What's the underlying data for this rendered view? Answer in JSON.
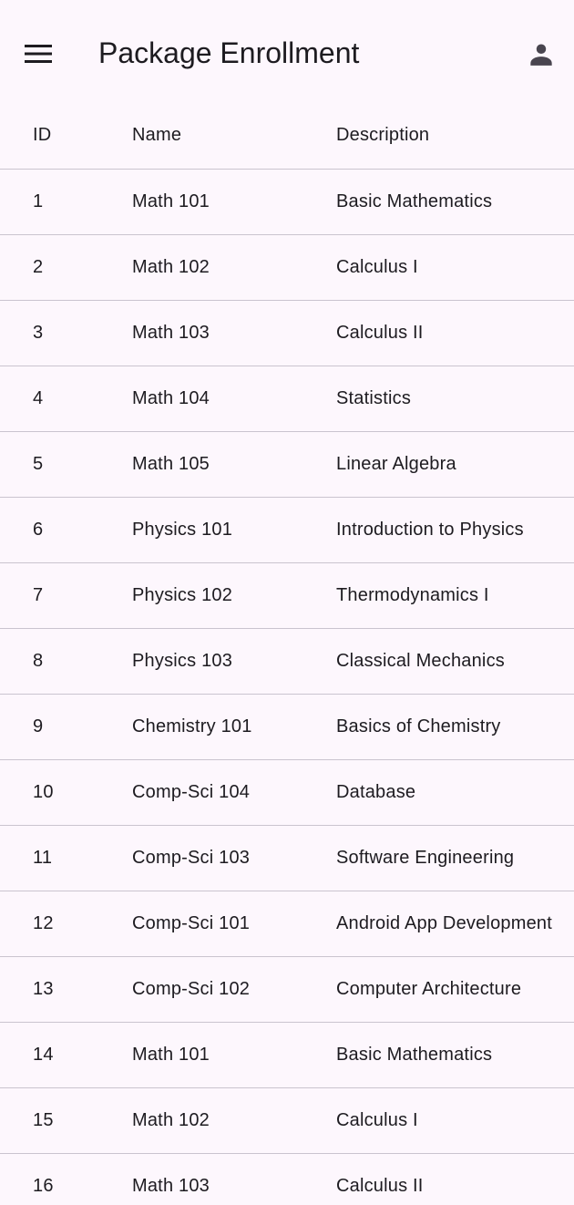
{
  "app_bar": {
    "title": "Package Enrollment",
    "menu_icon": "menu-icon",
    "account_icon": "account-icon"
  },
  "table": {
    "columns": [
      "ID",
      "Name",
      "Description"
    ],
    "rows": [
      {
        "id": "1",
        "name": "Math 101",
        "description": "Basic Mathematics"
      },
      {
        "id": "2",
        "name": "Math 102",
        "description": "Calculus I"
      },
      {
        "id": "3",
        "name": "Math 103",
        "description": "Calculus II"
      },
      {
        "id": "4",
        "name": "Math 104",
        "description": "Statistics"
      },
      {
        "id": "5",
        "name": "Math 105",
        "description": "Linear Algebra"
      },
      {
        "id": "6",
        "name": "Physics 101",
        "description": "Introduction to Physics"
      },
      {
        "id": "7",
        "name": "Physics 102",
        "description": "Thermodynamics I"
      },
      {
        "id": "8",
        "name": "Physics 103",
        "description": "Classical Mechanics"
      },
      {
        "id": "9",
        "name": "Chemistry 101",
        "description": "Basics of Chemistry"
      },
      {
        "id": "10",
        "name": "Comp-Sci 104",
        "description": "Database"
      },
      {
        "id": "11",
        "name": "Comp-Sci 103",
        "description": "Software Engineering"
      },
      {
        "id": "12",
        "name": "Comp-Sci 101",
        "description": "Android App Development"
      },
      {
        "id": "13",
        "name": "Comp-Sci 102",
        "description": "Computer Architecture"
      },
      {
        "id": "14",
        "name": "Math 101",
        "description": "Basic Mathematics"
      },
      {
        "id": "15",
        "name": "Math 102",
        "description": "Calculus I"
      },
      {
        "id": "16",
        "name": "Math 103",
        "description": "Calculus II"
      }
    ]
  },
  "colors": {
    "background": "#fdf7fd",
    "text": "#1d1b20",
    "divider": "#cac4cf",
    "icon": "#49454f"
  }
}
